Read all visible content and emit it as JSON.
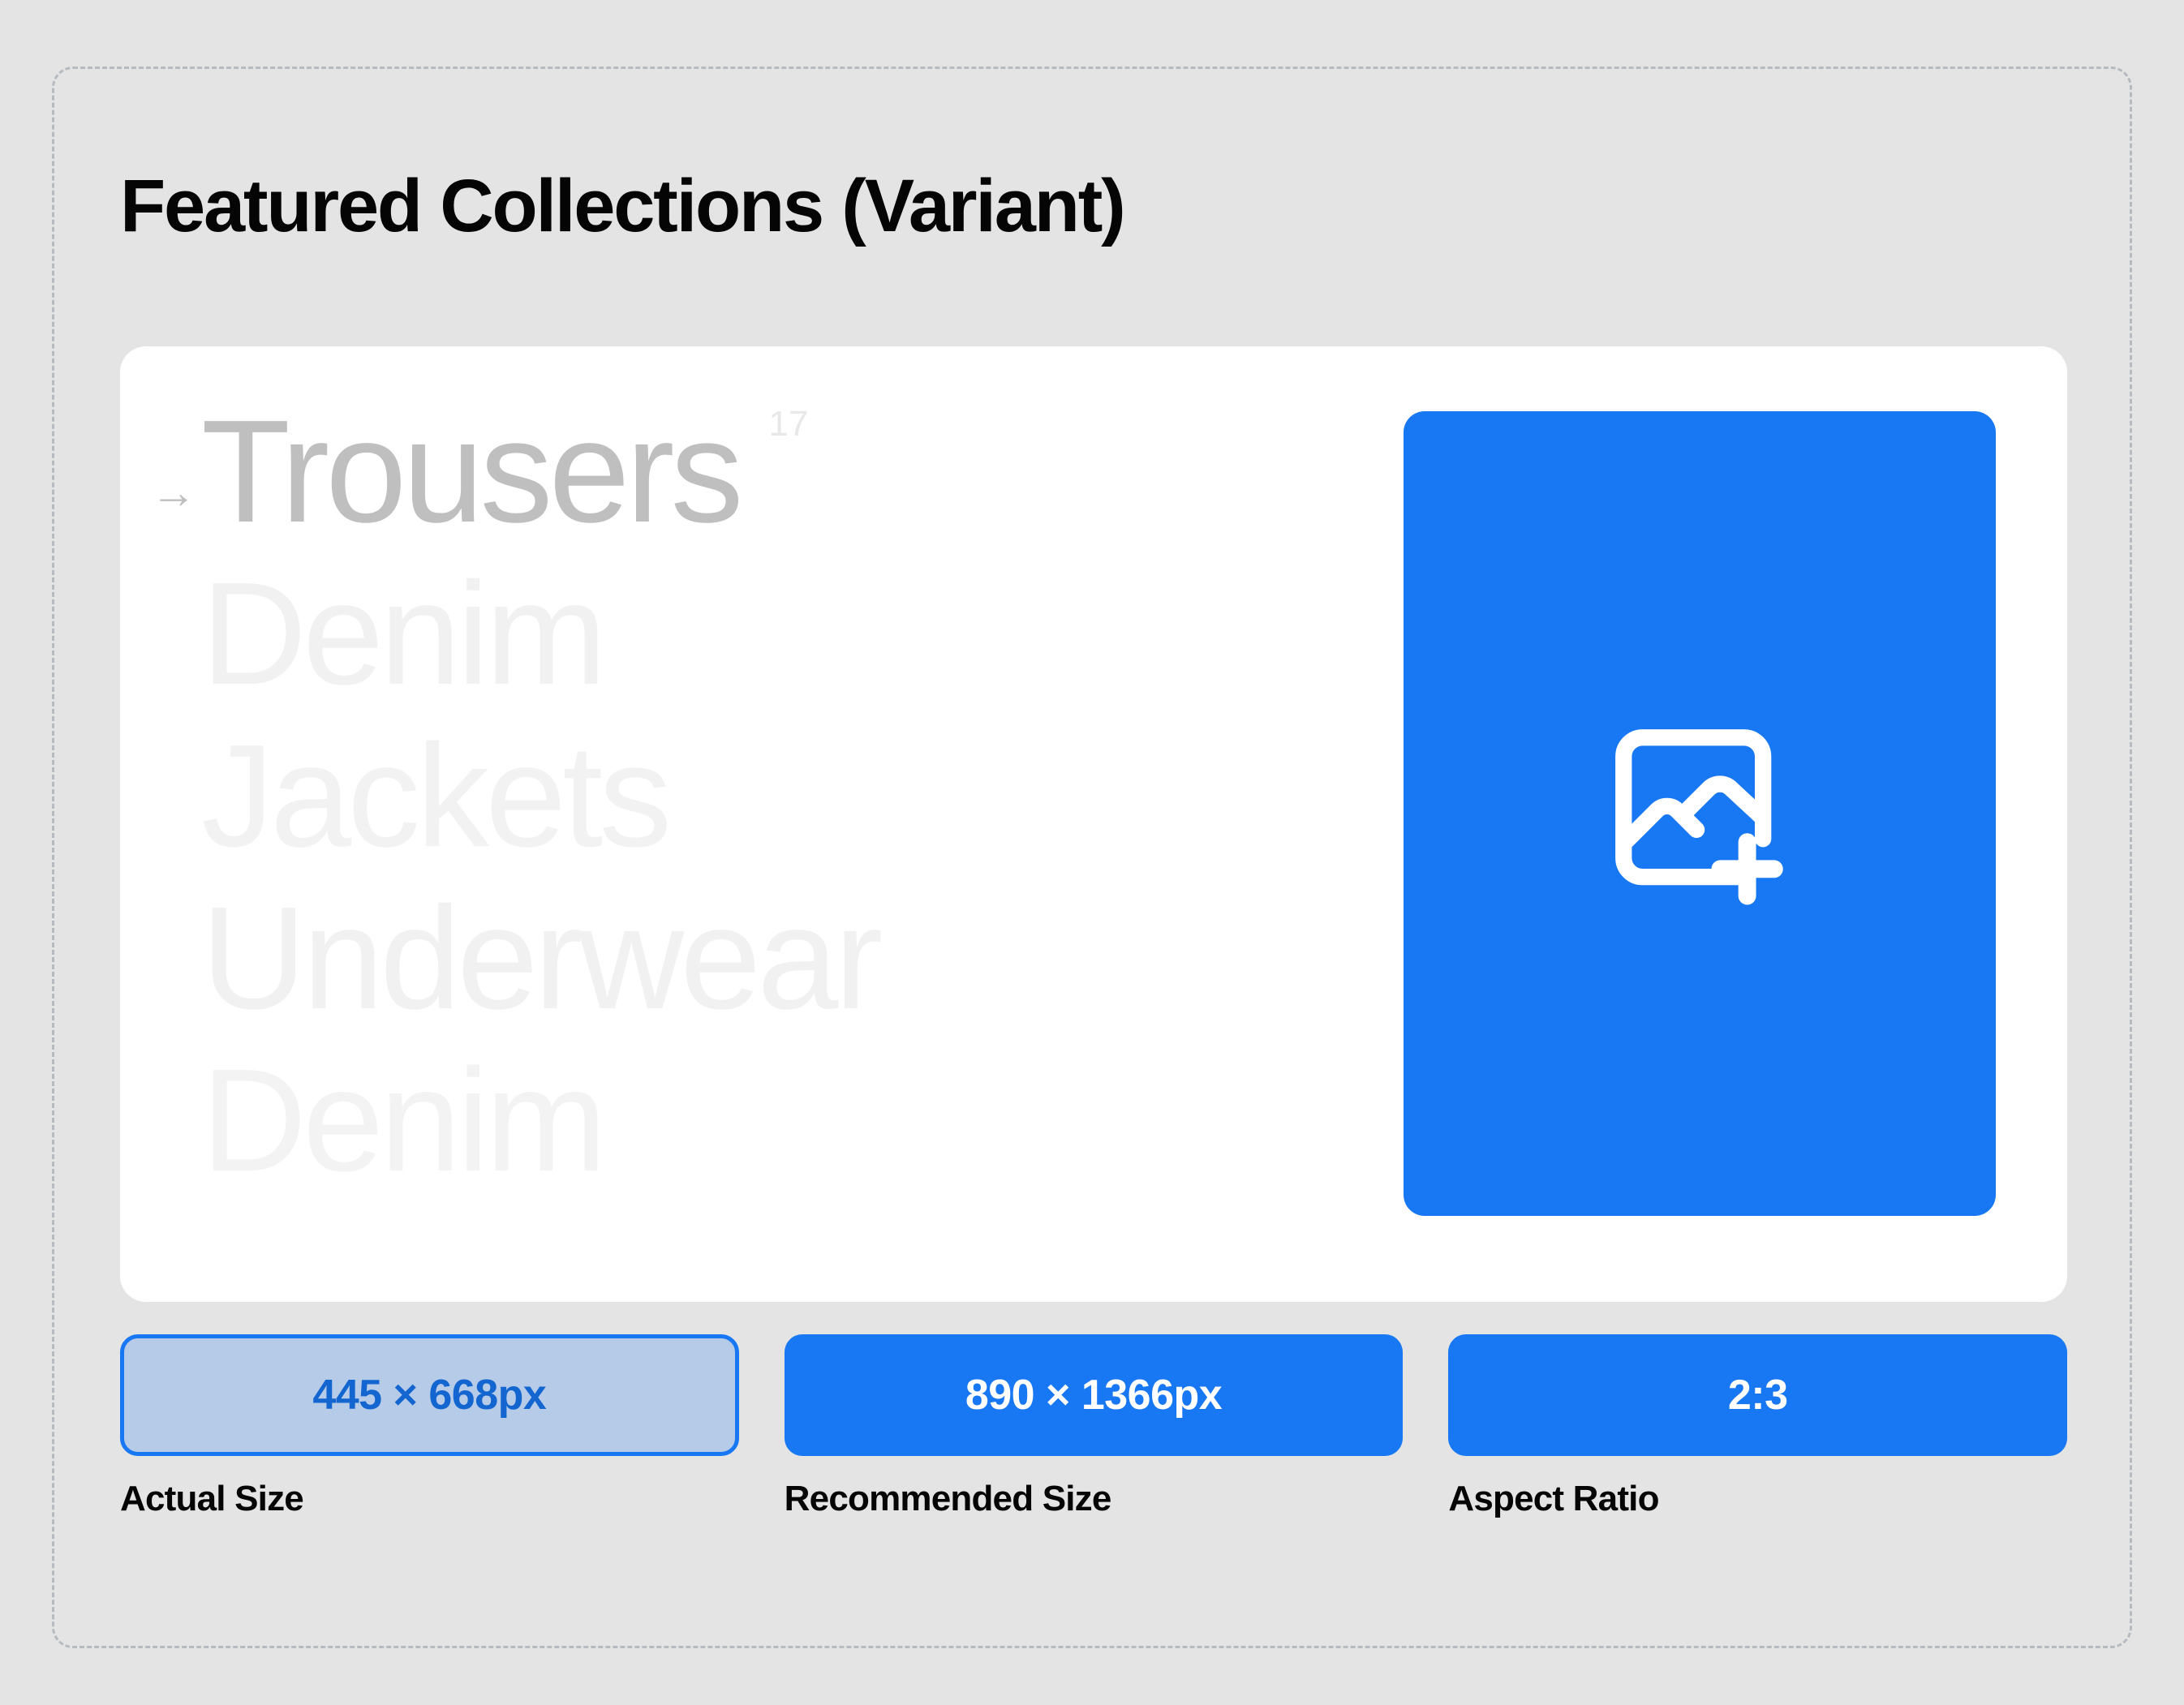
{
  "page": {
    "title": "Featured Collections (Variant)"
  },
  "preview": {
    "collections": [
      {
        "label": "Trousers",
        "count": "17",
        "active": true
      },
      {
        "label": "Denim",
        "count": "",
        "active": false
      },
      {
        "label": "Jackets",
        "count": "",
        "active": false
      },
      {
        "label": "Underwear",
        "count": "",
        "active": false
      },
      {
        "label": "Denim",
        "count": "",
        "active": false
      }
    ],
    "arrow_glyph": "→",
    "image_placeholder": {
      "icon": "add-image-icon",
      "background_color": "#1877f2"
    }
  },
  "specs": [
    {
      "value": "445 × 668px",
      "caption": "Actual Size",
      "style": "outline",
      "text_color": "#1365d0",
      "fill_color": "#b6cbe8"
    },
    {
      "value": "890 × 1366px",
      "caption": "Recommended Size",
      "style": "solid",
      "text_color": "#ffffff",
      "fill_color": "#1877f2"
    },
    {
      "value": "2:3",
      "caption": "Aspect Ratio",
      "style": "solid",
      "text_color": "#ffffff",
      "fill_color": "#1877f2"
    }
  ],
  "theme": {
    "accent": "#1877f2",
    "page_background": "#e4e4e4",
    "card_background": "#ffffff",
    "dashed_border": "#b6bbc2"
  }
}
